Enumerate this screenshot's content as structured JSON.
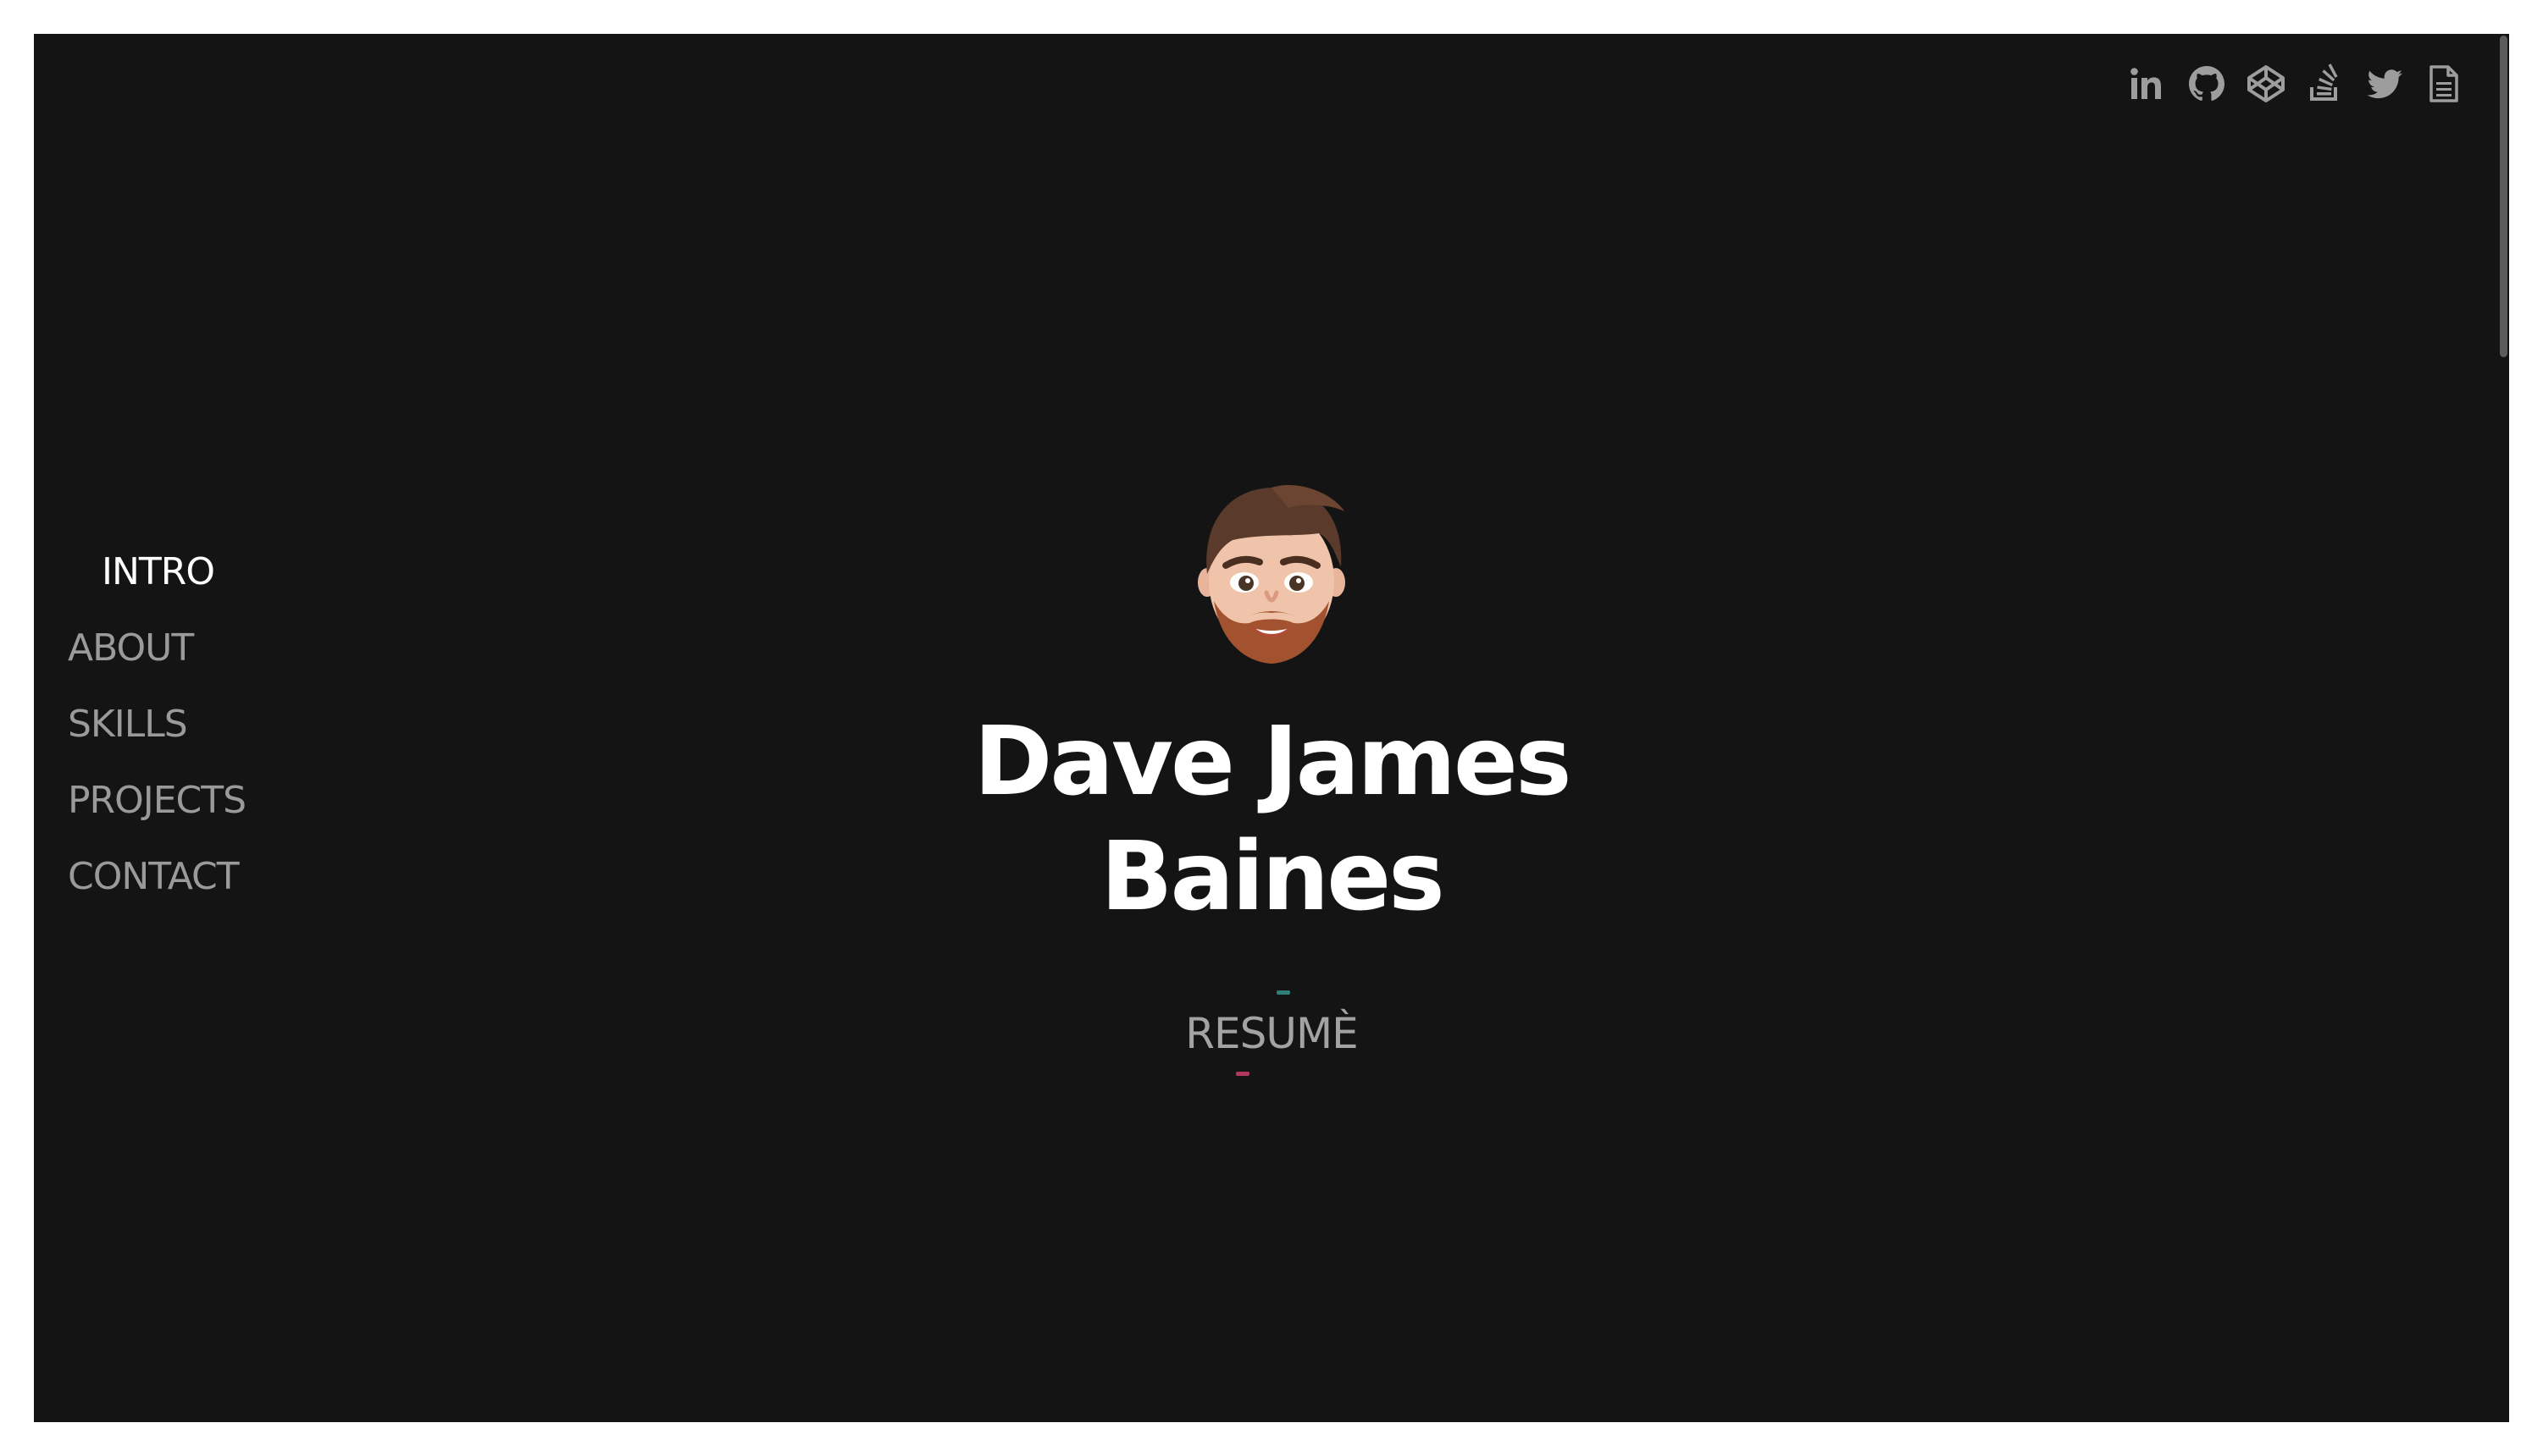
{
  "nav": {
    "items": [
      {
        "label": "INTRO"
      },
      {
        "label": "ABOUT"
      },
      {
        "label": "SKILLS"
      },
      {
        "label": "PROJECTS"
      },
      {
        "label": "CONTACT"
      }
    ],
    "active": "INTRO"
  },
  "social": {
    "icons": [
      "linkedin-icon",
      "github-icon",
      "codepen-icon",
      "stackoverflow-icon",
      "twitter-icon",
      "document-icon"
    ]
  },
  "hero": {
    "name_line1": "Dave James",
    "name_line2": "Baines",
    "resume_label": "RESUMÈ"
  },
  "colors": {
    "background": "#141414",
    "text": "#ffffff",
    "muted": "#9a9a9a",
    "icon": "#9d9d9d",
    "accent_teal": "#2f7f78",
    "accent_pink": "#b2375d"
  }
}
